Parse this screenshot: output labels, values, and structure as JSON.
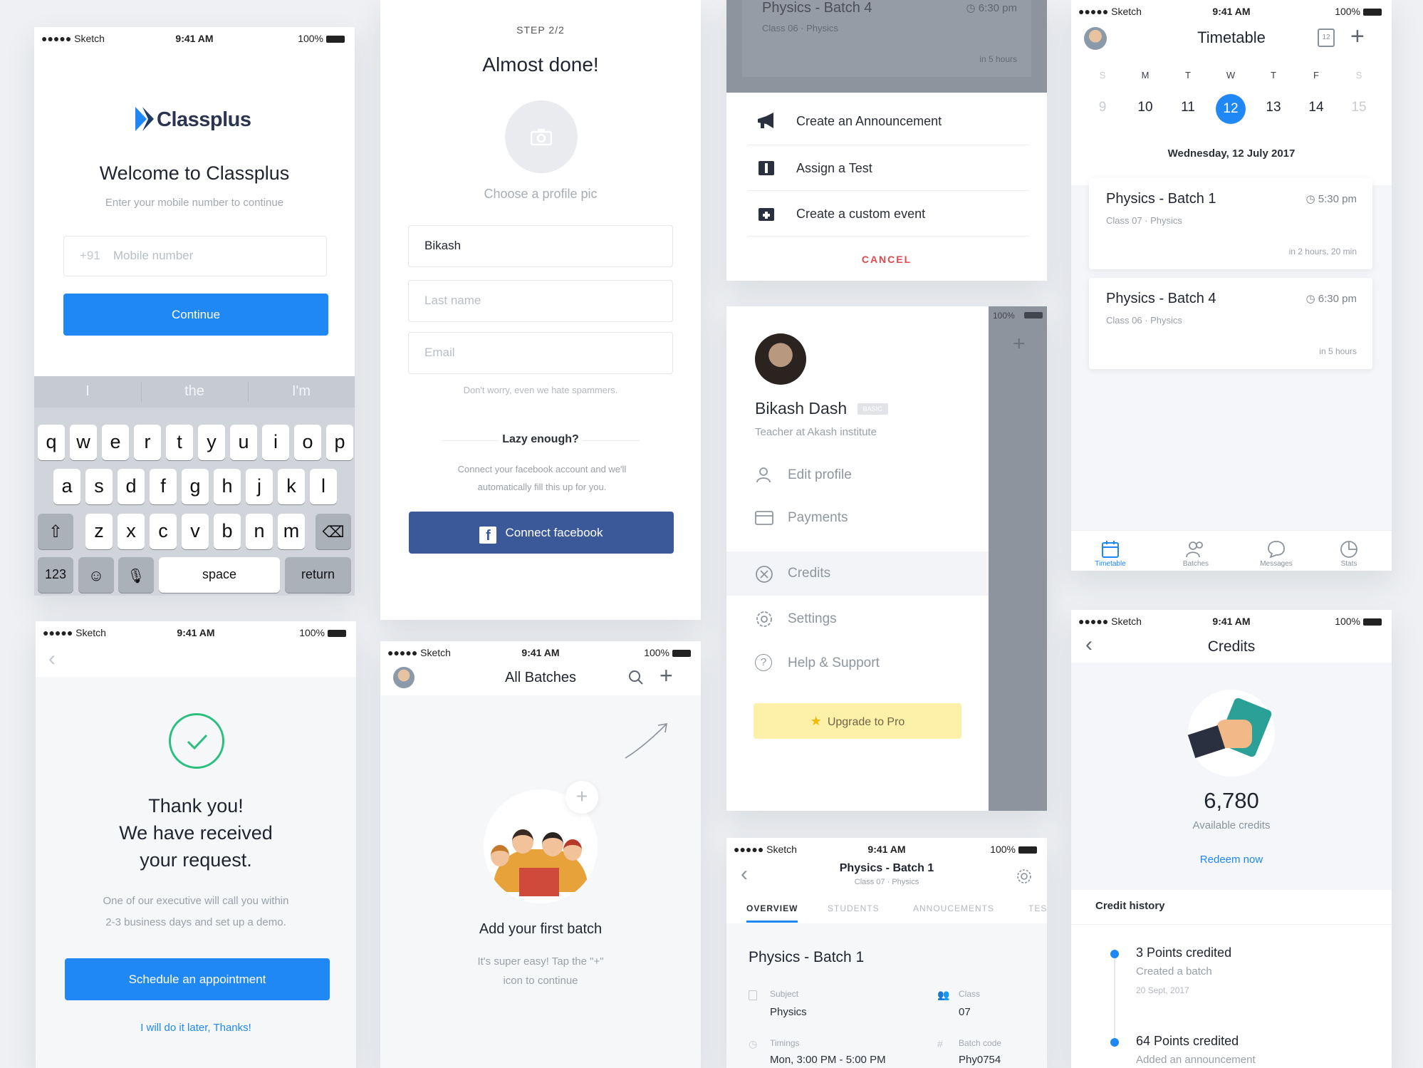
{
  "status": {
    "carrier": "●●●●● Sketch",
    "time": "9:41 AM",
    "battery": "100%"
  },
  "login": {
    "logo": "Classplus",
    "title": "Welcome to Classplus",
    "subtitle": "Enter your mobile number to continue",
    "code": "+91",
    "placeholder": "Mobile number",
    "continue": "Continue",
    "suggestions": [
      "I",
      "the",
      "I'm"
    ],
    "row1": [
      "q",
      "w",
      "e",
      "r",
      "t",
      "y",
      "u",
      "i",
      "o",
      "p"
    ],
    "row2": [
      "a",
      "s",
      "d",
      "f",
      "g",
      "h",
      "j",
      "k",
      "l"
    ],
    "row3": [
      "z",
      "x",
      "c",
      "v",
      "b",
      "n",
      "m"
    ],
    "k123": "123",
    "space": "space",
    "return": "return"
  },
  "profile": {
    "step": "STEP 2/2",
    "title": "Almost done!",
    "pic": "Choose a profile pic",
    "first": "Bikash",
    "last": "Last name",
    "email": "Email",
    "spam": "Don't worry, even we hate spammers.",
    "lazy": "Lazy enough?",
    "fb_text": "Connect your facebook account and we'll automatically fill this up for you.",
    "fb_btn": "Connect facebook"
  },
  "sheet": {
    "peek_title": "Physics - Batch 4",
    "peek_time": "6:30 pm",
    "peek_meta": "Class 06  ·  Physics",
    "peek_eta": "in 5 hours",
    "items": [
      "Create an Announcement",
      "Assign a Test",
      "Create a custom event"
    ],
    "cancel": "CANCEL"
  },
  "drawer": {
    "name": "Bikash Dash",
    "badge": "BASIC",
    "role": "Teacher at Akash institute",
    "items": [
      "Edit profile",
      "Payments",
      "Credits",
      "Settings",
      "Help & Support"
    ],
    "upgrade": "Upgrade to Pro"
  },
  "timetable": {
    "title": "Timetable",
    "cal_day": "12",
    "days": [
      "S",
      "M",
      "T",
      "W",
      "T",
      "F",
      "S"
    ],
    "dates": [
      "9",
      "10",
      "11",
      "12",
      "13",
      "14",
      "15"
    ],
    "date_label": "Wednesday, 12 July 2017",
    "events": [
      {
        "title": "Physics - Batch 1",
        "time": "5:30 pm",
        "meta": "Class 07  ·  Physics",
        "eta": "in 2 hours, 20 min"
      },
      {
        "title": "Physics - Batch 4",
        "time": "6:30 pm",
        "meta": "Class 06  ·  Physics",
        "eta": "in 5 hours"
      }
    ],
    "tabs": [
      "Timetable",
      "Batches",
      "Messages",
      "Stats"
    ]
  },
  "thanks": {
    "l1": "Thank you!",
    "l2": "We have received",
    "l3": "your request.",
    "b1": "One of our executive will call you within",
    "b2": "2-3 business days and set up a demo.",
    "schedule": "Schedule an appointment",
    "later": "I will do it later, Thanks!"
  },
  "batches": {
    "title": "All Batches",
    "empty_title": "Add your first batch",
    "e1": "It's super easy! Tap the \"+\"",
    "e2": "icon to continue"
  },
  "batch": {
    "title": "Physics - Batch 1",
    "sub": "Class 07 · Physics",
    "tabs": [
      "OVERVIEW",
      "STUDENTS",
      "ANNOUCEMENTS",
      "TES"
    ],
    "heading": "Physics - Batch 1",
    "subject_lbl": "Subject",
    "subject": "Physics",
    "class_lbl": "Class",
    "class": "07",
    "timings_lbl": "Timings",
    "timings": "Mon, 3:00 PM - 5:00 PM",
    "code_lbl": "Batch code",
    "code": "Phy0754"
  },
  "credits": {
    "title": "Credits",
    "amount": "6,780",
    "available": "Available credits",
    "redeem": "Redeem now",
    "history": "Credit history",
    "entries": [
      {
        "title": "3 Points credited",
        "desc": "Created a batch",
        "date": "20 Sept, 2017"
      },
      {
        "title": "64 Points credited",
        "desc": "Added an announcement"
      }
    ]
  },
  "colors": {
    "blue": "#2088f5",
    "facebook": "#3b5998",
    "green": "#2bbf7e",
    "cancel": "#e0484e",
    "upgrade": "#fdf0a8"
  }
}
